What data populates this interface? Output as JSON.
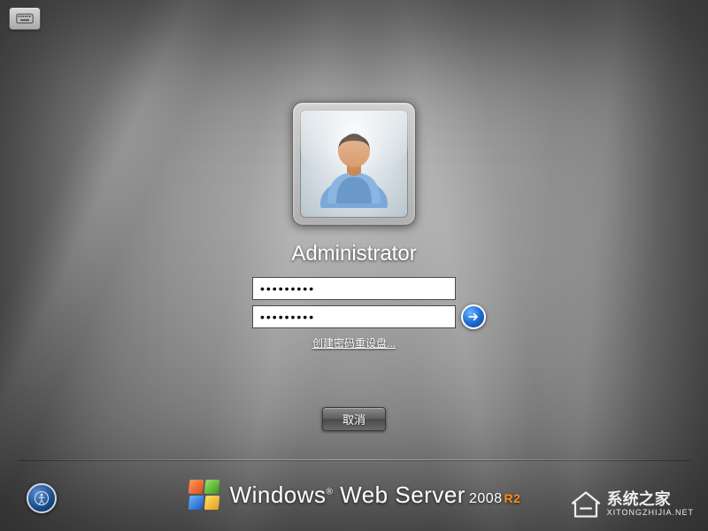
{
  "accessibility": {
    "top_button_name": "on-screen-keyboard"
  },
  "login": {
    "username": "Administrator",
    "password1_value": "•••••••••",
    "password2_value": "•••••••••",
    "reset_link": "创建密码重设盘...",
    "submit_name": "submit-arrow"
  },
  "actions": {
    "cancel_label": "取消"
  },
  "branding": {
    "prefix": "Windows",
    "tm": "®",
    "mid": "Web Server",
    "year": "2008",
    "suffix": "R2"
  },
  "watermark": {
    "main": "系统之家",
    "sub": "XITONGZHIJIA.NET"
  }
}
